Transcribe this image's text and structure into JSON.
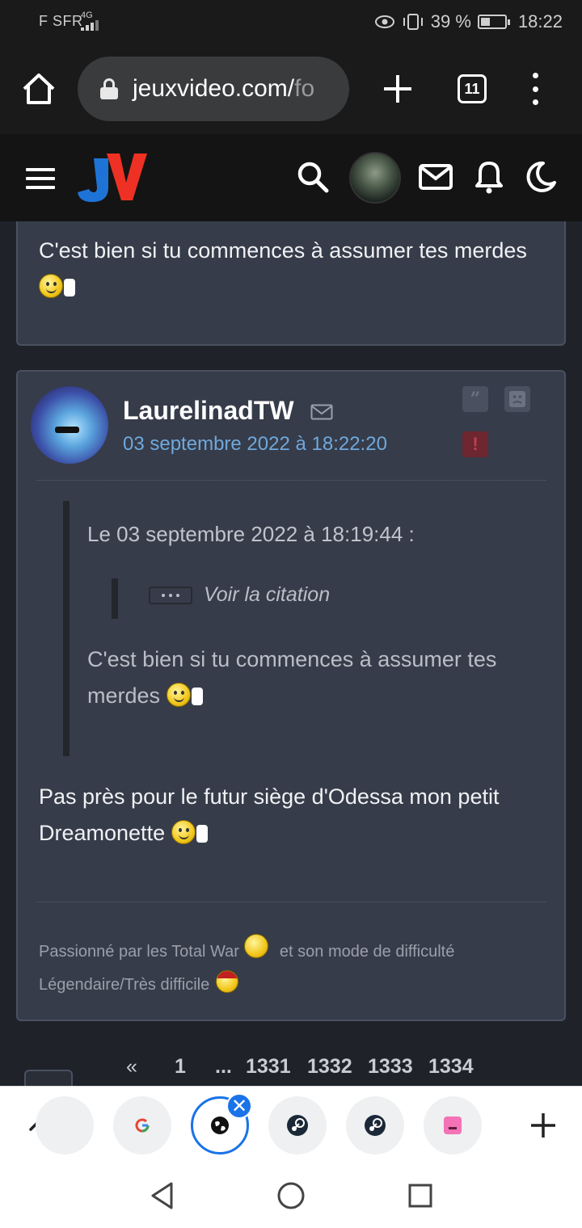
{
  "status_bar": {
    "carrier": "F SFR",
    "network": "4G",
    "battery_percent": "39 %",
    "battery_level": 0.39,
    "time": "18:22"
  },
  "browser": {
    "url_main": "jeuxvideo.com/",
    "url_fade": "fo",
    "tab_count": "11"
  },
  "site": {
    "logo_letters": "JV"
  },
  "previous_post": {
    "text": "C'est bien si tu commences à assumer tes merdes"
  },
  "post": {
    "author": "LaurelinadTW",
    "date": "03 septembre 2022 à 18:22:20",
    "quote_btn": "”",
    "alert_btn": "!",
    "quote": {
      "header": "Le 03 septembre 2022 à 18:19:44 :",
      "voir_label": "Voir la citation",
      "text": "C'est bien si tu commences à assumer tes merdes"
    },
    "body": "Pas près pour le futur siège d'Odessa mon petit Dreamonette",
    "signature_part1": "Passionné par les Total War",
    "signature_part2": "et son mode de difficulté Légendaire/Très difficile"
  },
  "pagination": {
    "prev": "«",
    "first_page": "1",
    "ellipsis": "...",
    "pages": [
      "1331",
      "1332",
      "1333",
      "1334"
    ]
  },
  "icons": {
    "home": "home-icon",
    "lock": "lock-icon",
    "search": "search-icon",
    "mail": "mail-icon",
    "bell": "bell-icon",
    "moon": "moon-icon"
  },
  "colors": {
    "card_bg": "#363c49",
    "date_link": "#6fa8dc",
    "chrome_blue": "#1a73e8",
    "logo_red": "#ee3124",
    "logo_blue": "#1e74d6"
  }
}
